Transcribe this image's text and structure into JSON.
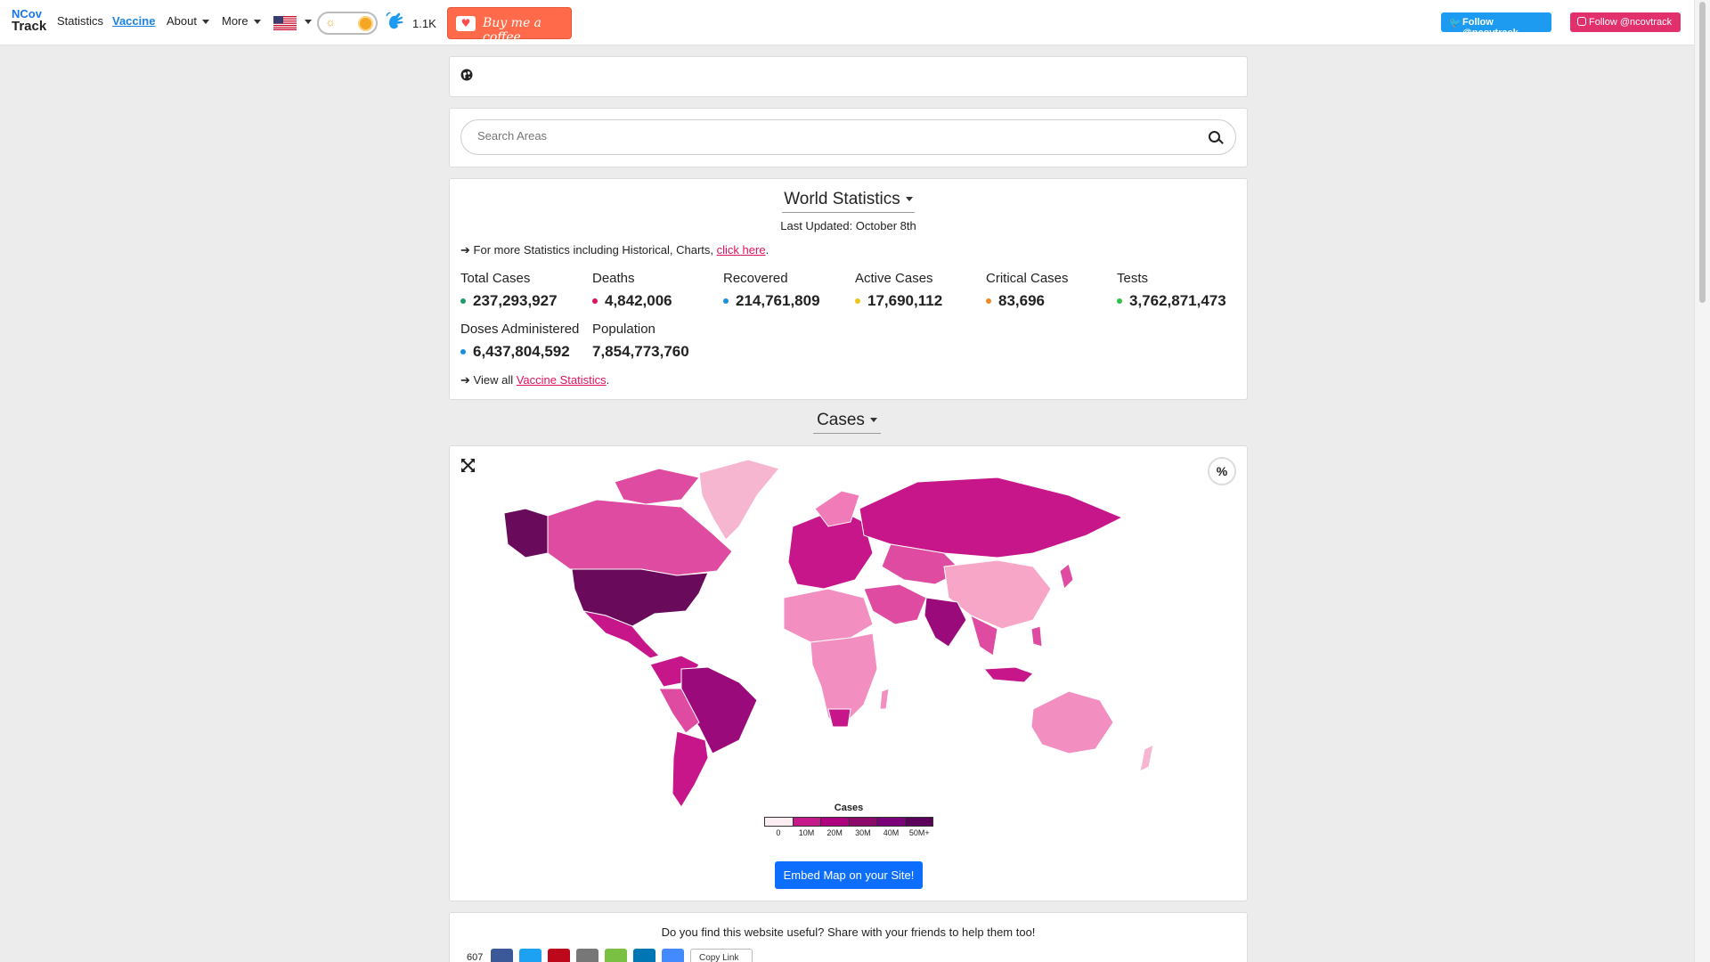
{
  "brand": {
    "line1": "NCov",
    "line2": "Track"
  },
  "nav": {
    "statistics": "Statistics",
    "vaccine": "Vaccine",
    "about": "About",
    "more": "More",
    "visitor_count": "1.1K",
    "coffee_label": "Buy me a coffee",
    "twitter_label": "Follow @ncovtrack",
    "instagram_label": "Follow @ncovtrack"
  },
  "search": {
    "placeholder": "Search Areas"
  },
  "world": {
    "title": "World Statistics",
    "last_updated": "Last Updated: October 8th",
    "more_prefix": "For more Statistics including Historical, Charts,",
    "more_link": "click here",
    "more_suffix": ".",
    "stats": [
      {
        "label": "Total Cases",
        "value": "237,293,927",
        "color": "#1e9a6b"
      },
      {
        "label": "Deaths",
        "value": "4,842,006",
        "color": "#e0115f"
      },
      {
        "label": "Recovered",
        "value": "214,761,809",
        "color": "#1a8fe0"
      },
      {
        "label": "Active Cases",
        "value": "17,690,112",
        "color": "#f2c31b"
      },
      {
        "label": "Critical Cases",
        "value": "83,696",
        "color": "#f08a24"
      },
      {
        "label": "Tests",
        "value": "3,762,871,473",
        "color": "#2ec04a"
      },
      {
        "label": "Doses Administered",
        "value": "6,437,804,592",
        "color": "#1a8fe0"
      },
      {
        "label": "Population",
        "value": "7,854,773,760"
      }
    ],
    "view_prefix": "View all",
    "view_link": "Vaccine Statistics",
    "view_suffix": "."
  },
  "map_section": {
    "selector": "Cases",
    "percent_button": "%",
    "legend_title": "Cases",
    "legend_ticks": [
      "0",
      "10M",
      "20M",
      "30M",
      "40M",
      "50M+"
    ],
    "legend_colors": [
      "#fdeef3",
      "#c51b8a",
      "#ae017e",
      "#8c0a6a",
      "#7a0177",
      "#5a005a"
    ],
    "embed_button": "Embed Map on your Site!"
  },
  "share": {
    "question": "Do you find this website useful? Share with your friends to help them too!",
    "count": "607",
    "copy_label": "Copy Link",
    "colors": [
      "#3b5998",
      "#1da1f2",
      "#bd081c",
      "#777777",
      "#7ac143",
      "#0077b5",
      "#448aff"
    ]
  }
}
